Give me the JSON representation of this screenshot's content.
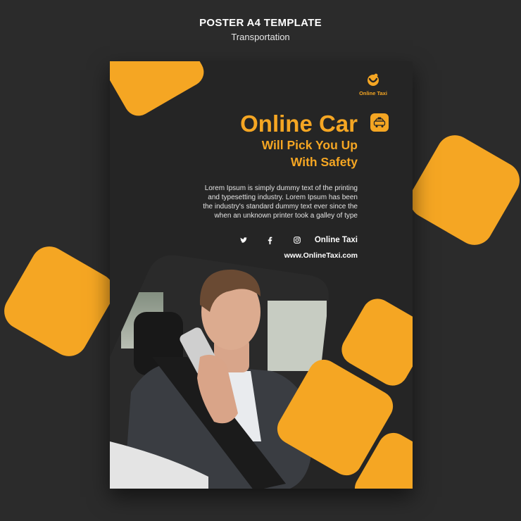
{
  "header": {
    "title": "POSTER A4 TEMPLATE",
    "subtitle": "Transportation"
  },
  "poster": {
    "logo_label": "Online Taxi",
    "headline": "Online Car",
    "subline_1": "Will Pick You Up",
    "subline_2": "With Safety",
    "body_lines": [
      "Lorem Ipsum is simply dummy text of the printing",
      "and typesetting industry. Lorem Ipsum has been",
      "the industry's standard dummy text ever since the",
      "when an unknown printer took a galley of type"
    ],
    "social": {
      "icons": [
        "twitter-icon",
        "facebook-icon",
        "instagram-icon"
      ],
      "handle": "Online Taxi"
    },
    "website": "www.OnlineTaxi.com",
    "photo_subject": "man-talking-on-phone-in-car"
  },
  "colors": {
    "background": "#2b2b2b",
    "poster": "#252525",
    "accent": "#f5a623",
    "text": "#ffffff"
  }
}
